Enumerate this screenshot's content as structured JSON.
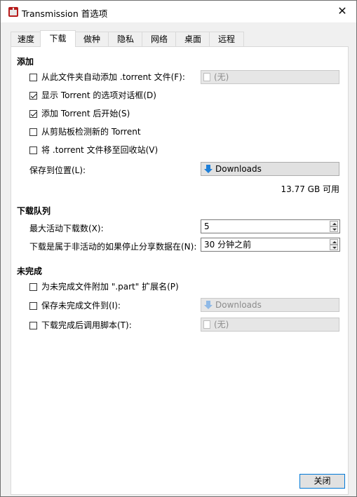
{
  "window": {
    "title": "Transmission 首选项"
  },
  "tabs": [
    {
      "label": "速度",
      "active": false
    },
    {
      "label": "下载",
      "active": true
    },
    {
      "label": "做种",
      "active": false
    },
    {
      "label": "隐私",
      "active": false
    },
    {
      "label": "网络",
      "active": false
    },
    {
      "label": "桌面",
      "active": false
    },
    {
      "label": "远程",
      "active": false
    }
  ],
  "add": {
    "heading": "添加",
    "watch_dir_label": "从此文件夹自动添加 .torrent 文件(F):",
    "watch_dir_value": "(无)",
    "show_options_label": "显示 Torrent 的选项对话框(D)",
    "start_after_add_label": "添加 Torrent 后开始(S)",
    "clipboard_detect_label": "从剪贴板检测新的 Torrent",
    "trash_torrent_label": "将 .torrent 文件移至回收站(V)",
    "save_to_label": "保存到位置(L):",
    "save_to_value": "Downloads",
    "free_space": "13.77 GB 可用"
  },
  "queue": {
    "heading": "下载队列",
    "max_active_label": "最大活动下载数(X):",
    "max_active_value": "5",
    "idle_label": "下载是属于非活动的如果停止分享数据在(N):",
    "idle_value": "30 分钟之前"
  },
  "incomplete": {
    "heading": "未完成",
    "part_ext_label": "为未完成文件附加 \".part\" 扩展名(P)",
    "incomplete_dir_label": "保存未完成文件到(I):",
    "incomplete_dir_value": "Downloads",
    "script_label": "下载完成后调用脚本(T):",
    "script_value": "(无)"
  },
  "footer": {
    "close_label": "关闭"
  },
  "colors": {
    "accent": "#0078d7",
    "arrow": "#1e7fd8"
  }
}
